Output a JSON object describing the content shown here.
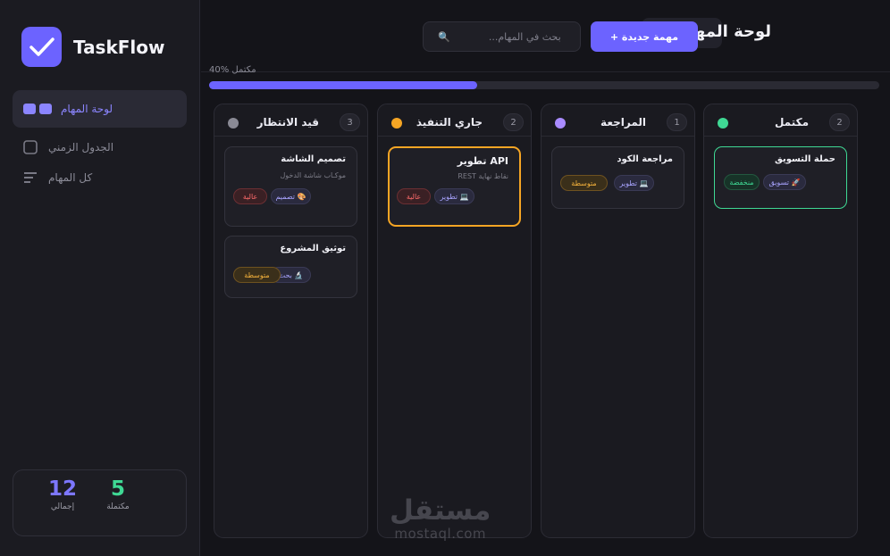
{
  "brand": {
    "name": "TaskFlow"
  },
  "nav": {
    "items": [
      {
        "label": "لوحة المهام",
        "icon": "board-icon",
        "active": true
      },
      {
        "label": "الجدول الزمني",
        "icon": "square-icon"
      },
      {
        "label": "كل المهام",
        "icon": "list-icon"
      }
    ]
  },
  "stats": {
    "total": {
      "value": "12",
      "label": "إجمالي"
    },
    "done": {
      "value": "5",
      "label": "مكتملة"
    }
  },
  "header": {
    "title": "لوحة المهام",
    "add_button": "+ مهمة جديدة",
    "search_placeholder": "بحث في المهام..."
  },
  "progress": {
    "label": "40% مكتمل",
    "percent": 40
  },
  "columns": [
    {
      "title": "قيد الانتظار",
      "count": "3",
      "dot_color": "#8a8a95",
      "cards": [
        {
          "title": "تصميم الشاشة",
          "desc": "موكـاب شاشة الدخول",
          "category": "تصميم 🎨",
          "priority": "عالية"
        },
        {
          "title": "توثيق المشروع",
          "desc": "",
          "category": "بحث 🔬",
          "priority": "متوسطة"
        }
      ]
    },
    {
      "title": "جاري التنفيذ",
      "count": "2",
      "dot_color": "#f5a524",
      "cards": [
        {
          "title": "تطوير API",
          "desc": "REST نقاط نهاية",
          "category": "تطوير 💻",
          "priority": "عالية"
        }
      ]
    },
    {
      "title": "المراجعة",
      "count": "1",
      "dot_color": "#a98bff",
      "cards": [
        {
          "title": "مراجعة الكود",
          "desc": "",
          "category": "تطوير 💻",
          "priority": "متوسطة"
        }
      ]
    },
    {
      "title": "مكتمل",
      "count": "2",
      "dot_color": "#3fd894",
      "cards": [
        {
          "title": "حملة التسويق",
          "desc": "",
          "category": "تسويق 🚀",
          "priority": "منخفضة"
        }
      ]
    }
  ],
  "watermark": {
    "arabic": "مستقل",
    "latin": "mostaql.com"
  },
  "colors": {
    "accent": "#6c63ff",
    "high": "#ff6b6b",
    "medium": "#f5b23c",
    "low": "#3fd894"
  }
}
